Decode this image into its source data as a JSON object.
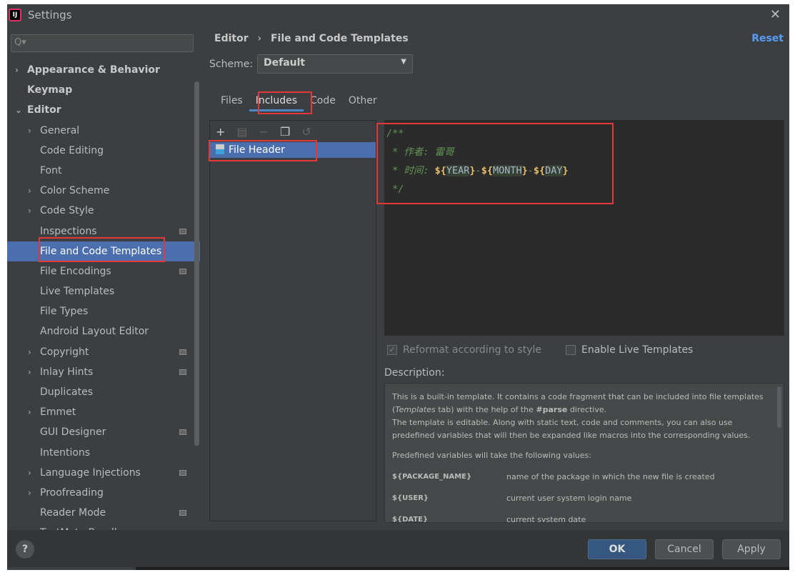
{
  "window": {
    "title": "Settings",
    "close": "✕"
  },
  "sidebar": {
    "search_placeholder": "Q▾",
    "items": [
      {
        "label": "Appearance & Behavior",
        "level": 0,
        "arrow": "›",
        "bold": true
      },
      {
        "label": "Keymap",
        "level": 0,
        "bold": true
      },
      {
        "label": "Editor",
        "level": 0,
        "arrow": "⌄",
        "bold": true
      },
      {
        "label": "General",
        "level": 1,
        "arrow": "›"
      },
      {
        "label": "Code Editing",
        "level": 1
      },
      {
        "label": "Font",
        "level": 1
      },
      {
        "label": "Color Scheme",
        "level": 1,
        "arrow": "›"
      },
      {
        "label": "Code Style",
        "level": 1,
        "arrow": "›"
      },
      {
        "label": "Inspections",
        "level": 1,
        "badge": true
      },
      {
        "label": "File and Code Templates",
        "level": 1,
        "selected": true
      },
      {
        "label": "File Encodings",
        "level": 1,
        "badge": true
      },
      {
        "label": "Live Templates",
        "level": 1
      },
      {
        "label": "File Types",
        "level": 1
      },
      {
        "label": "Android Layout Editor",
        "level": 1
      },
      {
        "label": "Copyright",
        "level": 1,
        "arrow": "›",
        "badge": true
      },
      {
        "label": "Inlay Hints",
        "level": 1,
        "arrow": "›",
        "badge": true
      },
      {
        "label": "Duplicates",
        "level": 1
      },
      {
        "label": "Emmet",
        "level": 1,
        "arrow": "›"
      },
      {
        "label": "GUI Designer",
        "level": 1,
        "badge": true
      },
      {
        "label": "Intentions",
        "level": 1
      },
      {
        "label": "Language Injections",
        "level": 1,
        "arrow": "›",
        "badge": true
      },
      {
        "label": "Proofreading",
        "level": 1,
        "arrow": "›"
      },
      {
        "label": "Reader Mode",
        "level": 1,
        "badge": true
      },
      {
        "label": "TextMate Bundles",
        "level": 1
      }
    ]
  },
  "main": {
    "breadcrumb": [
      "Editor",
      "File and Code Templates"
    ],
    "breadcrumb_sep": "›",
    "reset": "Reset",
    "scheme_label": "Scheme:",
    "scheme_value": "Default",
    "tabs": [
      {
        "label": "Files"
      },
      {
        "label": "Includes",
        "active": true
      },
      {
        "label": "Code"
      },
      {
        "label": "Other"
      }
    ],
    "toolbar": {
      "add": "+",
      "copy_icon": "▤",
      "remove": "−",
      "duplicate": "❐",
      "reset": "↺"
    },
    "list": [
      {
        "label": "File Header"
      }
    ],
    "editor": {
      "l1": "/**",
      "l2": " * 作者: 雷哥",
      "l3a": " * 时间: ",
      "v_year": "YEAR",
      "v_month": "MONTH",
      "v_day": "DAY",
      "dash": "-",
      "dollar": "${",
      "close": "}",
      "l4": " */"
    },
    "reformat": {
      "label": "Reformat according to style",
      "checked": true,
      "disabled": true
    },
    "live": {
      "label": "Enable Live Templates",
      "checked": false
    },
    "description_label": "Description:",
    "description": {
      "p1a": "This is a built-in template. It contains a code fragment that can be included into file templates (",
      "p1i": "Templates",
      "p1b": " tab) with the help of the ",
      "p1bold": "#parse",
      "p1c": " directive.",
      "p2": "The template is editable. Along with static text, code and comments, you can also use predefined variables that will then be expanded like macros into the corresponding values.",
      "p3": "Predefined variables will take the following values:",
      "vars": [
        {
          "name": "${PACKAGE_NAME}",
          "desc": "name of the package in which the new file is created"
        },
        {
          "name": "${USER}",
          "desc": "current user system login name"
        },
        {
          "name": "${DATE}",
          "desc": "current system date"
        }
      ]
    }
  },
  "footer": {
    "help": "?",
    "ok": "OK",
    "cancel": "Cancel",
    "apply": "Apply"
  },
  "colors": {
    "accent": "#4b6eaf",
    "highlight_box": "#e5383b",
    "link": "#589df6"
  }
}
